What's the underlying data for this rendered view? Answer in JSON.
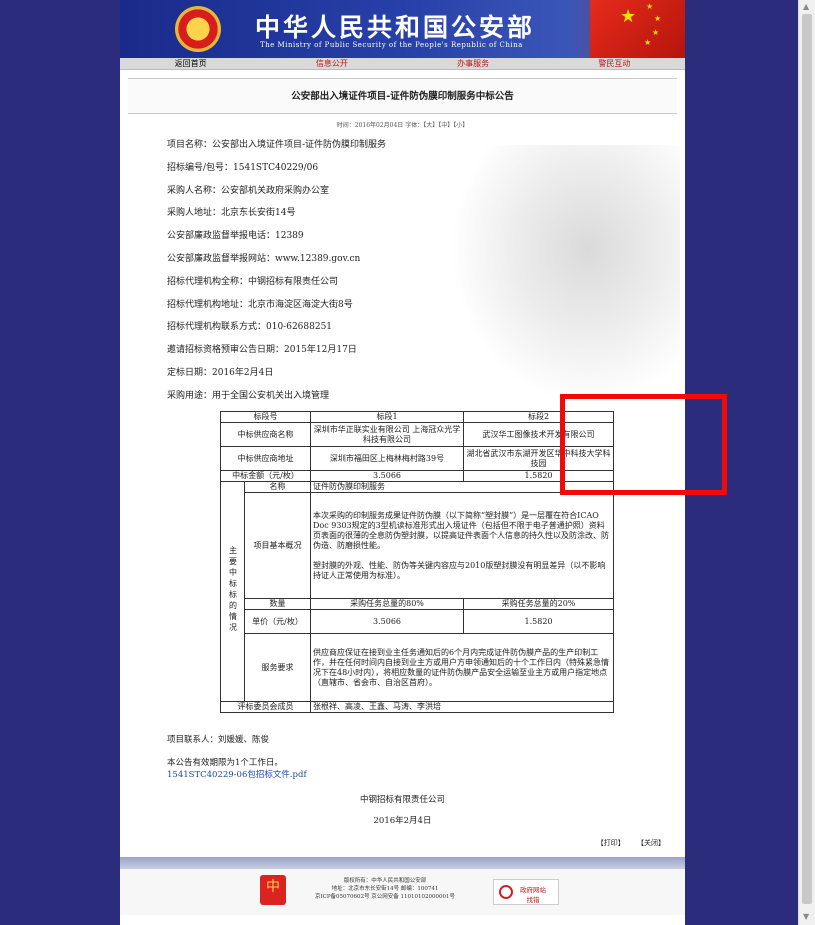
{
  "header": {
    "title_cn": "中华人民共和国公安部",
    "title_en": "The Ministry of Public Security of the People's Republic of China"
  },
  "nav": [
    "返回首页",
    "信息公开",
    "办事服务",
    "警民互动"
  ],
  "article": {
    "title": "公安部出入境证件项目-证件防伪膜印制服务中标公告",
    "meta": "时间：2016年02月04日 字体：【大】【中】【小】",
    "fields": [
      "项目名称：公安部出入境证件项目-证件防伪膜印制服务",
      "招标编号/包号：1541STC40229/06",
      "采购人名称：公安部机关政府采购办公室",
      "采购人地址：北京东长安街14号",
      "公安部廉政监督举报电话：12389",
      "公安部廉政监督举报网站：www.12389.gov.cn",
      "招标代理机构全称：中钢招标有限责任公司",
      "招标代理机构地址：北京市海淀区海淀大街8号",
      "招标代理机构联系方式：010-62688251",
      "邀请招标资格预审公告日期：2015年12月17日",
      "定标日期：2016年2月4日",
      "采购用途：用于全国公安机关出入境管理"
    ]
  },
  "table": {
    "h_section": "标段号",
    "h_s1": "标段1",
    "h_s2": "标段2",
    "r_supplier": "中标供应商名称",
    "s1_supplier": "深圳市华正联实业有限公司 上海冠众光学科技有限公司",
    "s2_supplier": "武汉华工图像技术开发有限公司",
    "r_address": "中标供应商地址",
    "s1_address": "深圳市福田区上梅林梅村路39号",
    "s2_address": "湖北省武汉市东湖开发区华中科技大学科技园",
    "r_amount": "中标金额（元/枚）",
    "s1_amount": "3.5066",
    "s2_amount": "1.5820",
    "side": "主要中标标的情况",
    "r_name": "名称",
    "v_name": "证件防伪膜印制服务",
    "r_basic": "项目基本概况",
    "v_basic_1": "本次采购的印制服务成果证件防伪膜（以下简称“塑封膜”）是一层覆在符合ICAO Doc 9303规定的3型机读标准形式出入境证件（包括但不限于电子普通护照）资料页表面的很薄的全息防伪塑封膜，以提高证件表面个人信息的持久性以及防涂改、防伪造、防磨损性能。",
    "v_basic_2": "塑封膜的外观、性能、防伪等关键内容应与2010版塑封膜没有明显差异（以不影响持证人正常使用为标准）。",
    "r_qty": "数量",
    "v_qty1": "采购任务总量的80%",
    "v_qty2": "采购任务总量的20%",
    "r_price": "单价（元/枚）",
    "v_price1": "3.5066",
    "v_price2": "1.5820",
    "r_service": "服务要求",
    "v_service": "供应商应保证在接到业主任务通知后的6个月内完成证件防伪膜产品的生产印制工作，并在任何时间内自接到业主方或用户方申领通知后的十个工作日内（特殊紧急情况下在48小时内），将相应数量的证件防伪膜产品安全运输至业主方或用户指定地点（直辖市、省会市、自治区首府）。",
    "r_committee": "评标委员会成员",
    "v_committee": "张根祥、高凌、王鑫、马涛、李洪培"
  },
  "after": {
    "contact": "项目联系人：刘媛媛、陈俊",
    "validity": "本公告有效期限为1个工作日。",
    "attachment": "1541STC40229-06包招标文件.pdf",
    "org": "中钢招标有限责任公司",
    "date": "2016年2月4日",
    "print": "【打印】",
    "close": "【关闭】"
  },
  "footer": {
    "logo_text": "中",
    "host": "版权所有：中华人民共和国公安部",
    "addr": "地址：北京市东长安街14号  邮编：100741",
    "icp": "京ICP备05070602号  京公网安备 11010102000001号",
    "gov_label": "政府网站",
    "gov_sub": "找错"
  },
  "colors": {
    "banner": "#2740a8",
    "nav_active": "#b5191c",
    "highlight": "#f20a0a",
    "background": "#2b2d7c"
  }
}
